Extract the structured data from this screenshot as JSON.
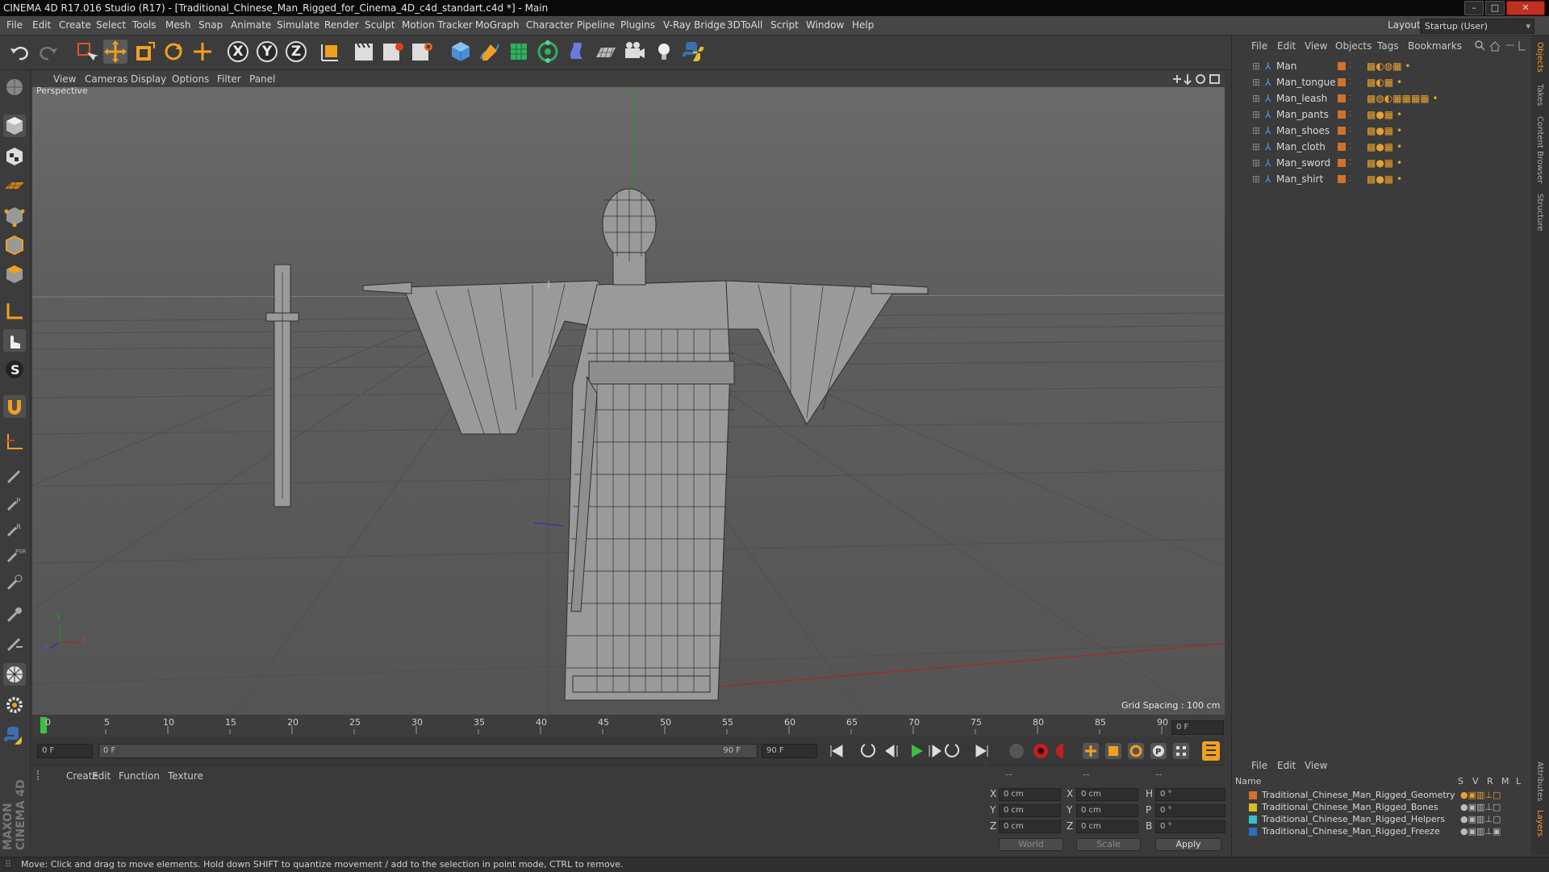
{
  "window": {
    "title": "CINEMA 4D R17.016 Studio (R17) - [Traditional_Chinese_Man_Rigged_for_Cinema_4D_c4d_standart.c4d *] - Main",
    "minimize": "–",
    "maximize": "□",
    "close": "✕"
  },
  "menubar": {
    "items": [
      "File",
      "Edit",
      "Create",
      "Select",
      "Tools",
      "Mesh",
      "Snap",
      "Animate",
      "Simulate",
      "Render",
      "Sculpt",
      "Motion Tracker",
      "MoGraph",
      "Character",
      "Pipeline",
      "Plugins",
      "V-Ray Bridge",
      "3DToAll",
      "Script",
      "Window",
      "Help"
    ],
    "layout_label": "Layout:",
    "layout_value": "Startup (User)"
  },
  "toolbar": {
    "axis_x": "X",
    "axis_y": "Y",
    "axis_z": "Z"
  },
  "viewport": {
    "menu": [
      "View",
      "Cameras",
      "Display",
      "Options",
      "Filter",
      "Panel"
    ],
    "label": "Perspective",
    "grid_spacing": "Grid Spacing : 100 cm",
    "axis_y": "y",
    "axis_z": "z",
    "axis_x": "x"
  },
  "timeline": {
    "ticks": [
      "0",
      "5",
      "10",
      "15",
      "20",
      "25",
      "30",
      "35",
      "40",
      "45",
      "50",
      "55",
      "60",
      "65",
      "70",
      "75",
      "80",
      "85",
      "90"
    ],
    "current_frame": "0 F",
    "start_field": "0 F",
    "range_start": "0 F",
    "range_end": "90 F",
    "end_field": "90 F"
  },
  "materials": {
    "menu": [
      "Create",
      "Edit",
      "Function",
      "Texture"
    ]
  },
  "coords": {
    "header_dashes": "--",
    "x_label": "X",
    "y_label": "Y",
    "z_label": "Z",
    "x_pos": "0 cm",
    "y_pos": "0 cm",
    "z_pos": "0 cm",
    "x_size": "0 cm",
    "y_size": "0 cm",
    "z_size": "0 cm",
    "h_label": "H",
    "p_label": "P",
    "b_label": "B",
    "h_val": "0 °",
    "p_val": "0 °",
    "b_val": "0 °",
    "mode_world": "World",
    "mode_scale": "Scale",
    "apply": "Apply"
  },
  "objects": {
    "menu": [
      "File",
      "Edit",
      "View",
      "Objects",
      "Tags",
      "Bookmarks"
    ],
    "items": [
      "Man",
      "Man_tongue",
      "Man_leash",
      "Man_pants",
      "Man_shoes",
      "Man_cloth",
      "Man_sword",
      "Man_shirt"
    ]
  },
  "layers": {
    "menu": [
      "File",
      "Edit",
      "View"
    ],
    "header_name": "Name",
    "header_cols": [
      "S",
      "V",
      "R",
      "M",
      "L"
    ],
    "items": [
      {
        "name": "Traditional_Chinese_Man_Rigged_Geometry",
        "color": "#d3702c"
      },
      {
        "name": "Traditional_Chinese_Man_Rigged_Bones",
        "color": "#d8c020"
      },
      {
        "name": "Traditional_Chinese_Man_Rigged_Helpers",
        "color": "#38c0c8"
      },
      {
        "name": "Traditional_Chinese_Man_Rigged_Freeze",
        "color": "#2a6fc0"
      }
    ]
  },
  "right_tabs": [
    "Objects",
    "Takes",
    "Content Browser",
    "Structure",
    "Attributes",
    "Layers"
  ],
  "branding": "MAXON CINEMA 4D",
  "status": "Move: Click and drag to move elements. Hold down SHIFT to quantize movement / add to the selection in point mode, CTRL to remove.",
  "colors": {
    "accent_orange": "#d3702c",
    "viewport_bg": "#5e5e5e",
    "axis_green": "#1e9e1e",
    "axis_red": "#b02020",
    "axis_blue": "#2a2ac0"
  }
}
